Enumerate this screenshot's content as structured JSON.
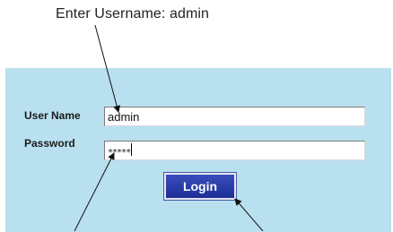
{
  "callout": {
    "text": "Enter Username: admin"
  },
  "form": {
    "username_label": "User Name",
    "username_value": "admin",
    "password_label": "Password",
    "password_value": "*****",
    "login_label": "Login"
  },
  "colors": {
    "panel_bg": "#b9e0ef",
    "button_bg": "#2a3ca8",
    "button_text": "#ffffff"
  }
}
